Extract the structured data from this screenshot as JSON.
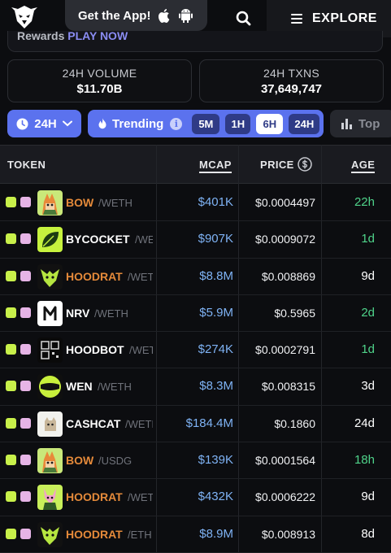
{
  "header": {
    "get_app": "Get the App!",
    "explore": "EXPLORE",
    "icons": [
      "eagle-logo",
      "apple-icon",
      "android-icon",
      "search-icon",
      "menu-icon"
    ]
  },
  "rewards": {
    "prefix": "Rewards",
    "link": "PLAY NOW"
  },
  "stats": [
    {
      "label": "24H VOLUME",
      "value": "$11.70B"
    },
    {
      "label": "24H TXNS",
      "value": "37,649,747"
    }
  ],
  "filters": {
    "period": "24H",
    "trending": "Trending",
    "timeframes": [
      "5M",
      "1H",
      "6H",
      "24H"
    ],
    "active_timeframe": "6H",
    "top": "Top"
  },
  "table": {
    "columns": {
      "token": "TOKEN",
      "mcap": "MCAP",
      "price": "PRICE",
      "age": "AGE"
    },
    "rows": [
      {
        "name": "BOW",
        "pair": "/WETH",
        "mcap": "$401K",
        "price": "$0.0004497",
        "age": "22h",
        "name_color": "#e58a3a",
        "age_color": "#4fd38a",
        "avatar": "fox"
      },
      {
        "name": "BYCOCKET",
        "pair": "/WET",
        "mcap": "$907K",
        "price": "$0.0009072",
        "age": "1d",
        "name_color": "#ffffff",
        "age_color": "#4fd38a",
        "avatar": "leaf"
      },
      {
        "name": "HOODRAT",
        "pair": "/WETH",
        "mcap": "$8.8M",
        "price": "$0.008869",
        "age": "9d",
        "name_color": "#e58a3a",
        "age_color": "#ffffff",
        "avatar": "rat-green"
      },
      {
        "name": "NRV",
        "pair": "/WETH",
        "mcap": "$5.9M",
        "price": "$0.5965",
        "age": "2d",
        "name_color": "#ffffff",
        "age_color": "#4fd38a",
        "avatar": "nrv"
      },
      {
        "name": "HOODBOT",
        "pair": "/WETH",
        "mcap": "$274K",
        "price": "$0.0002791",
        "age": "1d",
        "name_color": "#ffffff",
        "age_color": "#4fd38a",
        "avatar": "bot"
      },
      {
        "name": "WEN",
        "pair": "/WETH",
        "mcap": "$8.3M",
        "price": "$0.008315",
        "age": "3d",
        "name_color": "#ffffff",
        "age_color": "#ffffff",
        "avatar": "wen"
      },
      {
        "name": "CASHCAT",
        "pair": "/WETH",
        "mcap": "$184.4M",
        "price": "$0.1860",
        "age": "24d",
        "name_color": "#ffffff",
        "age_color": "#ffffff",
        "avatar": "cat"
      },
      {
        "name": "BOW",
        "pair": "/USDG",
        "mcap": "$139K",
        "price": "$0.0001564",
        "age": "18h",
        "name_color": "#e58a3a",
        "age_color": "#4fd38a",
        "avatar": "fox"
      },
      {
        "name": "HOODRAT",
        "pair": "/WETH",
        "mcap": "$432K",
        "price": "$0.0006222",
        "age": "9d",
        "name_color": "#e58a3a",
        "age_color": "#ffffff",
        "avatar": "rat-pink"
      },
      {
        "name": "HOODRAT",
        "pair": "/ETH",
        "mcap": "$8.9M",
        "price": "$0.008913",
        "age": "8d",
        "name_color": "#e58a3a",
        "age_color": "#ffffff",
        "avatar": "rat-green"
      }
    ]
  }
}
